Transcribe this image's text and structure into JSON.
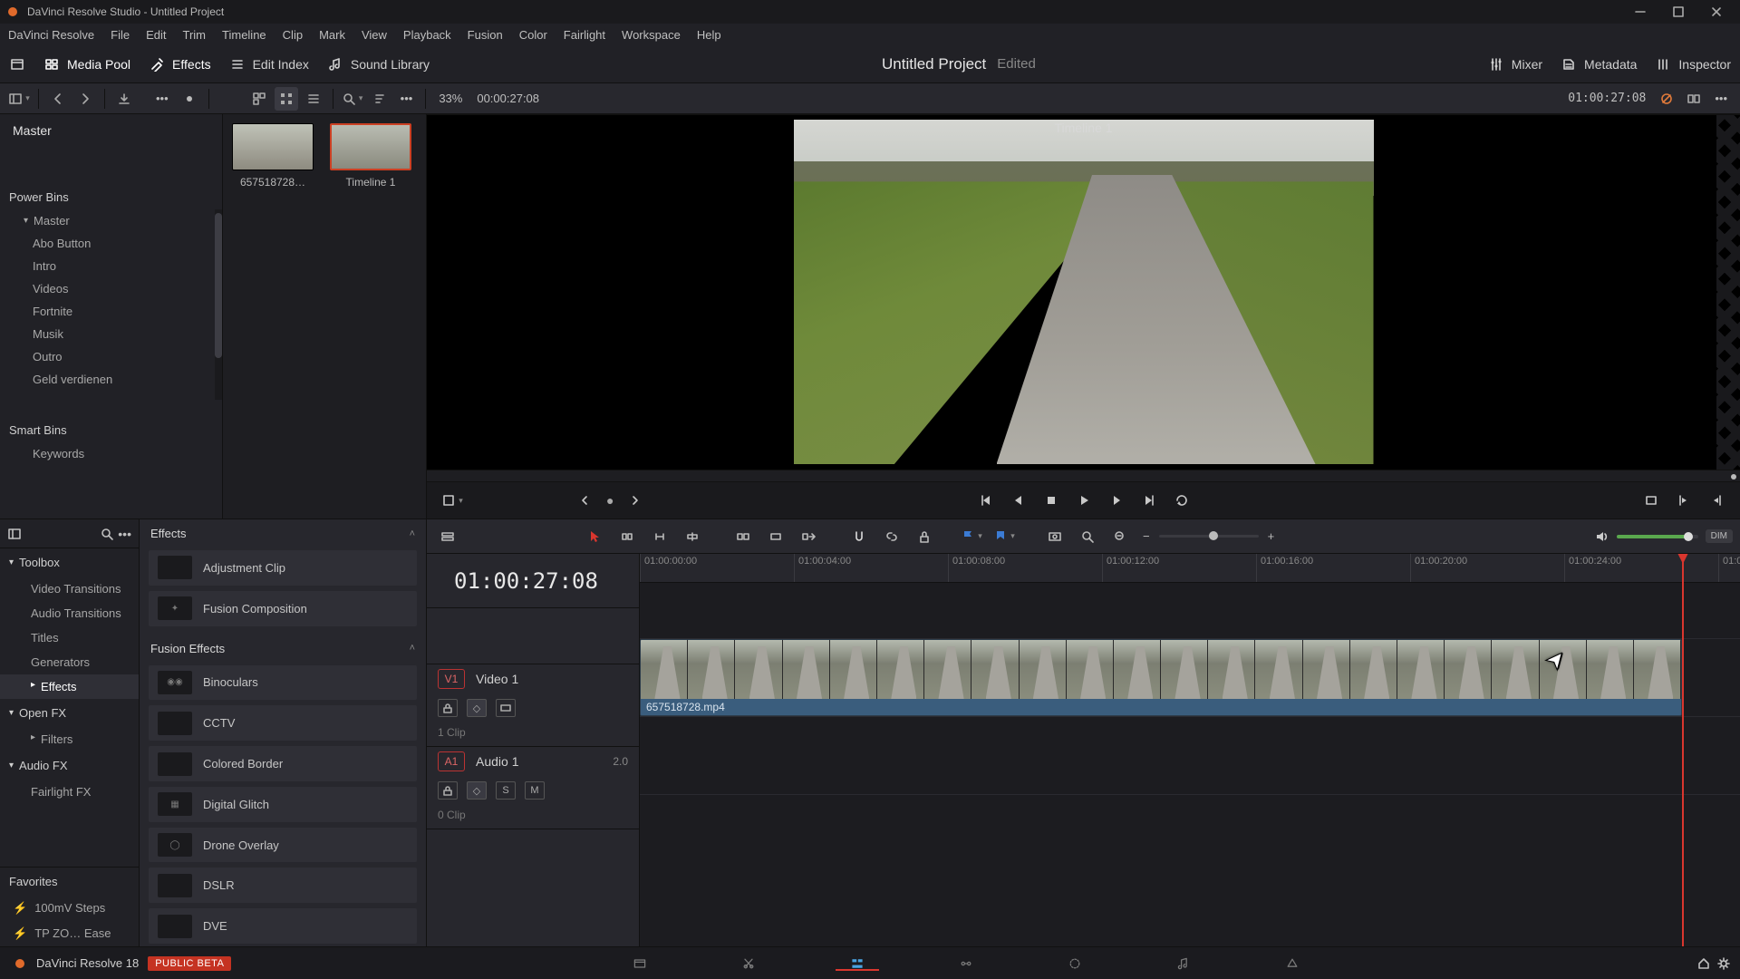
{
  "window": {
    "title": "DaVinci Resolve Studio - Untitled Project"
  },
  "menu": [
    "DaVinci Resolve",
    "File",
    "Edit",
    "Trim",
    "Timeline",
    "Clip",
    "Mark",
    "View",
    "Playback",
    "Fusion",
    "Color",
    "Fairlight",
    "Workspace",
    "Help"
  ],
  "panels": {
    "media_pool": "Media Pool",
    "effects": "Effects",
    "edit_index": "Edit Index",
    "sound_library": "Sound Library",
    "mixer": "Mixer",
    "metadata": "Metadata",
    "inspector": "Inspector"
  },
  "project": {
    "name": "Untitled Project",
    "state": "Edited"
  },
  "pool_toolbar": {
    "zoom": "33%",
    "source_tc": "00:00:27:08"
  },
  "bins": {
    "master": "Master",
    "power": "Power Bins",
    "power_root": "Master",
    "power_items": [
      "Abo Button",
      "Intro",
      "Videos",
      "Fortnite",
      "Musik",
      "Outro",
      "Geld verdienen"
    ],
    "smart": "Smart Bins",
    "smart_items": [
      "Keywords"
    ]
  },
  "pool_thumbs": [
    {
      "name": "657518728…",
      "selected": false
    },
    {
      "name": "Timeline 1",
      "selected": true
    }
  ],
  "viewer": {
    "title": "Timeline 1",
    "tc": "01:00:27:08"
  },
  "fx": {
    "toolbox": "Toolbox",
    "cats": [
      "Video Transitions",
      "Audio Transitions",
      "Titles",
      "Generators"
    ],
    "effects_cat": "Effects",
    "openfx": "Open FX",
    "filters": "Filters",
    "audiofx": "Audio FX",
    "fairlightfx": "Fairlight FX",
    "favorites": "Favorites",
    "fav_items": [
      "100mV Steps",
      "TP ZO… Ease"
    ],
    "section_effects": "Effects",
    "section_fusion": "Fusion Effects",
    "list_effects": [
      "Adjustment Clip",
      "Fusion Composition"
    ],
    "list_fusion": [
      "Binoculars",
      "CCTV",
      "Colored Border",
      "Digital Glitch",
      "Drone Overlay",
      "DSLR",
      "DVE"
    ]
  },
  "timeline": {
    "big_tc": "01:00:27:08",
    "ticks": [
      "01:00:00:00",
      "01:00:04:00",
      "01:00:08:00",
      "01:00:12:00",
      "01:00:16:00",
      "01:00:20:00",
      "01:00:24:00",
      "01:0"
    ],
    "video_track": {
      "tag": "V1",
      "name": "Video 1",
      "clips": "1 Clip",
      "clip_label": "657518728.mp4"
    },
    "audio_track": {
      "tag": "A1",
      "name": "Audio 1",
      "ch": "2.0",
      "clips": "0 Clip"
    },
    "dim": "DIM"
  },
  "footer": {
    "app": "DaVinci Resolve 18",
    "beta": "PUBLIC BETA"
  }
}
